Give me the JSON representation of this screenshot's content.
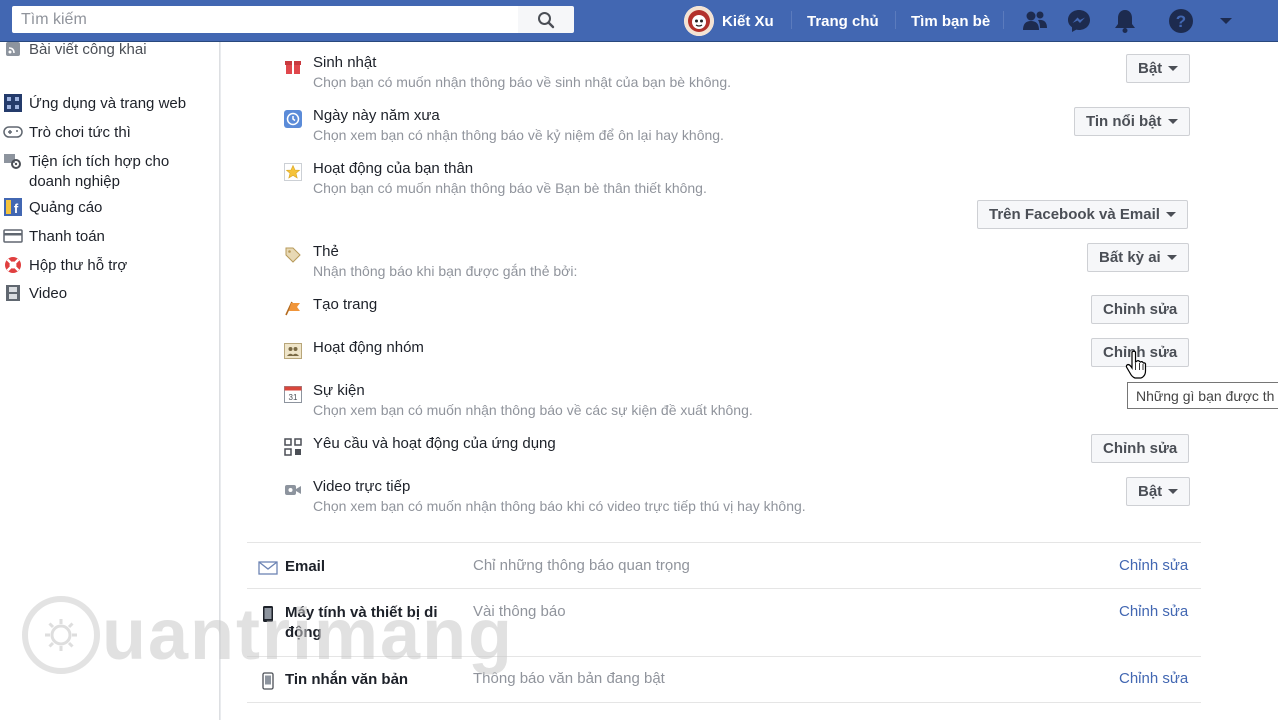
{
  "topbar": {
    "search_placeholder": "Tìm kiếm",
    "user_name": "Kiết Xu",
    "home_label": "Trang chủ",
    "find_friends_label": "Tìm bạn bè"
  },
  "sidebar": {
    "items": [
      {
        "label": "Bài viết công khai",
        "icon": "rss-icon"
      },
      {
        "label": "Ứng dụng và trang web",
        "icon": "apps-icon"
      },
      {
        "label": "Trò chơi tức thì",
        "icon": "gamepad-icon"
      },
      {
        "label": "Tiện ích tích hợp cho doanh nghiệp",
        "icon": "business-gear-icon"
      },
      {
        "label": "Quảng cáo",
        "icon": "ads-icon"
      },
      {
        "label": "Thanh toán",
        "icon": "card-icon"
      },
      {
        "label": "Hộp thư hỗ trợ",
        "icon": "lifebuoy-icon"
      },
      {
        "label": "Video",
        "icon": "film-icon"
      }
    ]
  },
  "notifications": {
    "birthday": {
      "title": "Sinh nhật",
      "desc": "Chọn bạn có muốn nhận thông báo về sinh nhật của bạn bè không.",
      "button": "Bật"
    },
    "memories": {
      "title": "Ngày này năm xưa",
      "desc": "Chọn xem bạn có nhận thông báo về kỷ niệm để ôn lại hay không.",
      "button": "Tin nổi bật"
    },
    "close_friends": {
      "title": "Hoạt động của bạn thân",
      "desc": "Chọn bạn có muốn nhận thông báo về Bạn bè thân thiết không.",
      "button": "Trên Facebook và Email"
    },
    "tags": {
      "title": "Thẻ",
      "desc": "Nhận thông báo khi bạn được gắn thẻ bởi:",
      "button": "Bất kỳ ai"
    },
    "pages": {
      "title": "Tạo trang",
      "button": "Chỉnh sửa"
    },
    "groups": {
      "title": "Hoạt động nhóm",
      "button": "Chỉnh sửa"
    },
    "events": {
      "title": "Sự kiện",
      "desc": "Chọn xem bạn có muốn nhận thông báo về các sự kiện đề xuất không."
    },
    "apps": {
      "title": "Yêu cầu và hoạt động của ứng dụng",
      "button": "Chỉnh sửa"
    },
    "live_video": {
      "title": "Video trực tiếp",
      "desc": "Chọn xem bạn có muốn nhận thông báo khi có video trực tiếp thú vị hay không.",
      "button": "Bật"
    }
  },
  "tooltip": "Những gì bạn được th",
  "channels": [
    {
      "name": "Email",
      "value": "Chỉ những thông báo quan trọng",
      "edit": "Chỉnh sửa"
    },
    {
      "name": "Máy tính và thiết bị di động",
      "value": "Vài thông báo",
      "edit": "Chỉnh sửa"
    },
    {
      "name": "Tin nhắn văn bản",
      "value": "Thông báo văn bản đang bật",
      "edit": "Chỉnh sửa"
    }
  ],
  "watermark": "uantrimang",
  "colors": {
    "brand": "#4267b2",
    "muted": "#90949c",
    "link": "#4267b2"
  }
}
